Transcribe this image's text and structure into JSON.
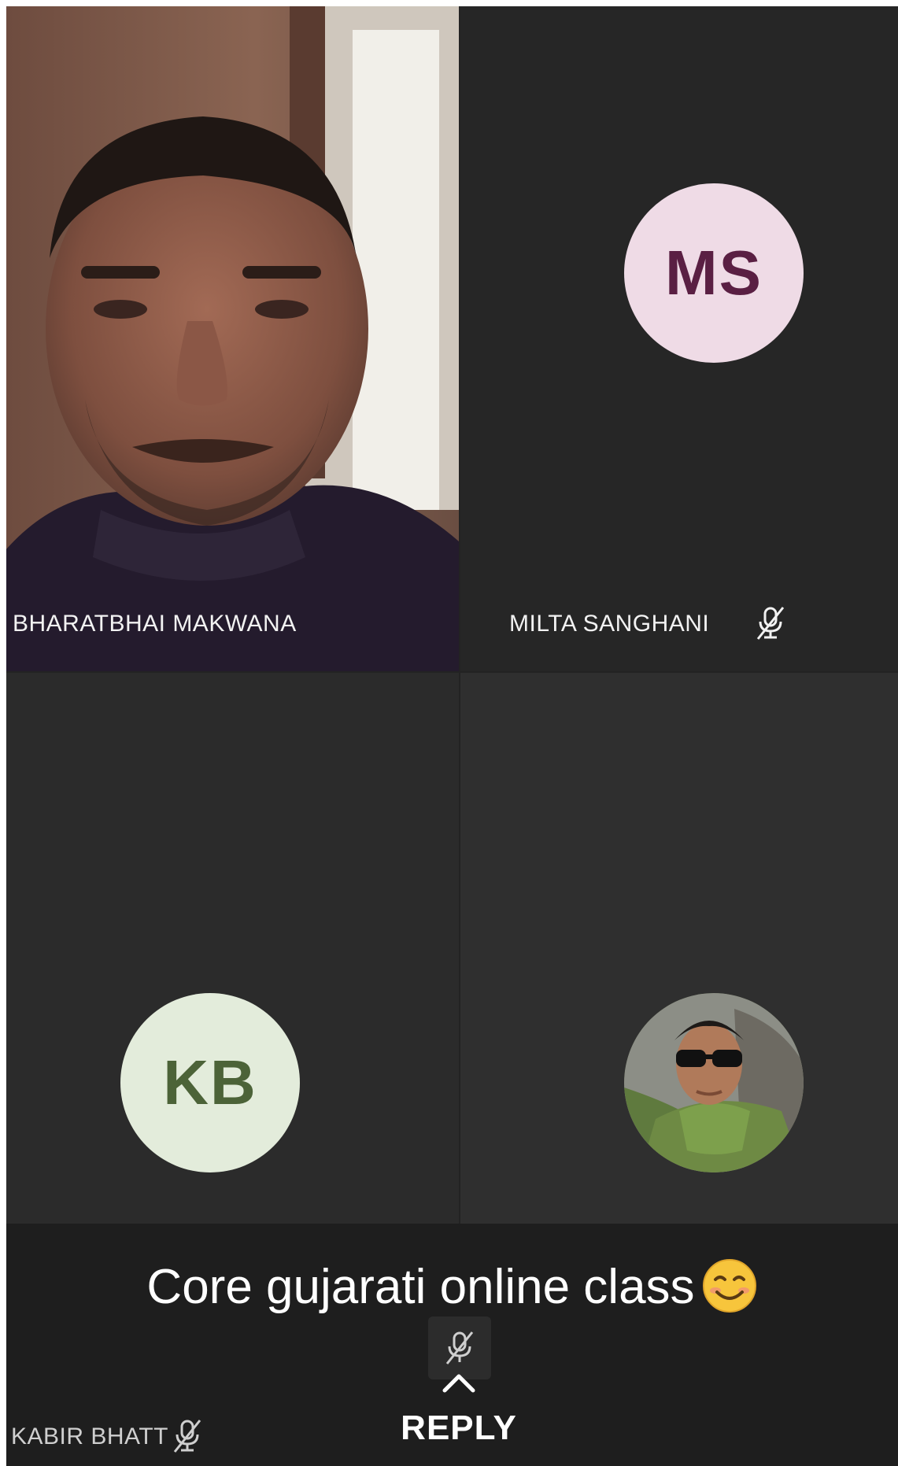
{
  "participants": [
    {
      "name": "BHARATBHAI MAKWANA",
      "muted": false,
      "media": "camera-video"
    },
    {
      "name": "MILTA SANGHANI",
      "muted": true,
      "initials": "MS",
      "avatar_bg": "#efdbe6",
      "avatar_fg": "#5a1f43"
    },
    {
      "name": "",
      "initials": "KB",
      "avatar_bg": "#e3ecdb",
      "avatar_fg": "#4c6338"
    },
    {
      "name": "",
      "media": "profile-photo"
    }
  ],
  "presenter_bar": {
    "name": "KABIR BHATT",
    "muted": true
  },
  "caption": {
    "text": "Core gujarati online class",
    "emoji": "smiling-face-icon"
  },
  "reply": {
    "label": "REPLY"
  },
  "colors": {
    "background": "#232323",
    "text": "#ffffff"
  }
}
